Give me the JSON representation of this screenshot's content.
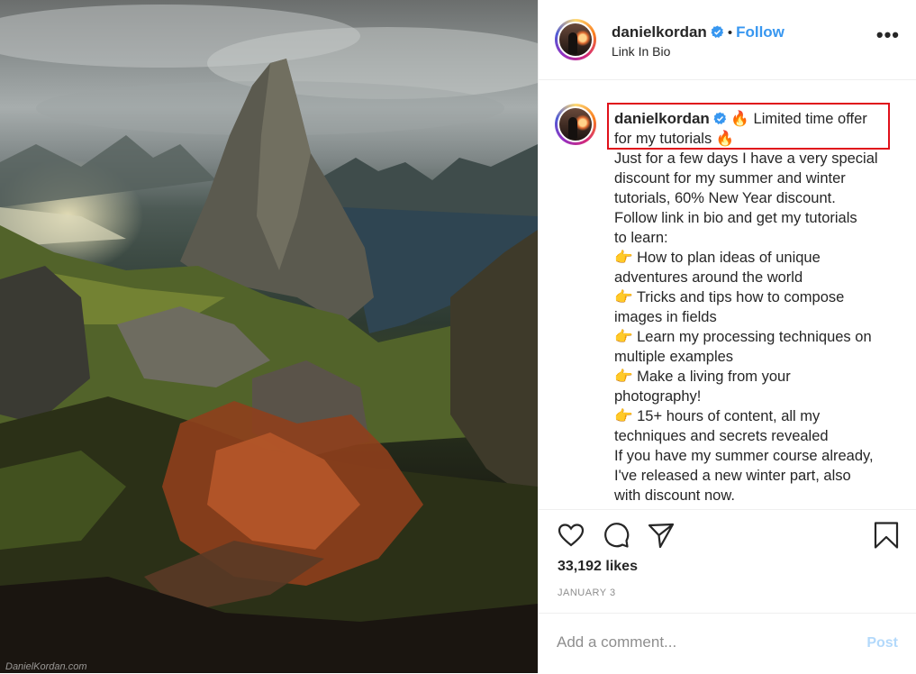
{
  "post": {
    "photo_watermark": "DanielKordan.com",
    "photo_description_icon": "mountain-landscape-photo"
  },
  "header": {
    "username": "danielkordan",
    "separator": "•",
    "follow_label": "Follow",
    "subtitle": "Link In Bio",
    "more_icon": "ellipsis-icon",
    "more_label": "•••"
  },
  "caption": {
    "username": "danielkordan",
    "lines": [
      " 🔥 Limited time offer",
      "for my tutorials 🔥",
      "Just for a few days I have a very special",
      "discount for my summer and winter",
      "tutorials, 60% New Year discount.",
      "Follow link in bio and get my tutorials",
      "to learn:",
      "👉 How to plan ideas of unique",
      "adventures around the world",
      "👉 Tricks and tips how to compose",
      "images in fields",
      "👉 Learn my processing techniques on",
      "multiple examples",
      "👉 Make a living from your",
      "photography!",
      "👉 15+ hours of content, all my",
      "techniques and secrets revealed",
      "If you have my summer course already,",
      "I've released a new winter part, also",
      "with discount now."
    ]
  },
  "actions": {
    "icons": [
      "heart-icon",
      "comment-icon",
      "share-icon",
      "bookmark-icon"
    ],
    "likes": "33,192 likes",
    "date": "JANUARY 3"
  },
  "comment": {
    "placeholder": "Add a comment...",
    "post_label": "Post"
  },
  "colors": {
    "accent": "#3897f0",
    "highlight_border": "#e0101a",
    "post_disabled": "#b3d9fb",
    "muted": "#8e8e8e"
  }
}
